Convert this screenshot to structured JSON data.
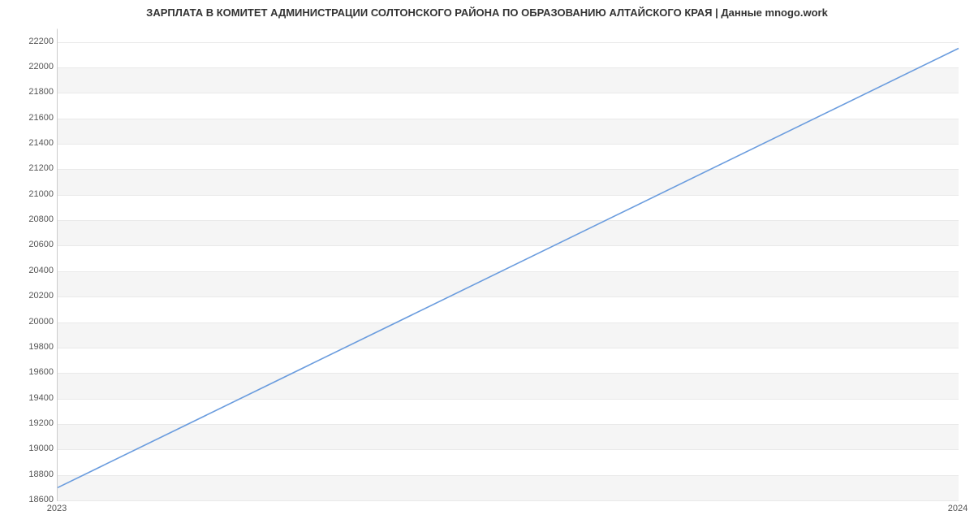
{
  "chart_data": {
    "type": "line",
    "title": "ЗАРПЛАТА В КОМИТЕТ АДМИНИСТРАЦИИ СОЛТОНСКОГО РАЙОНА ПО ОБРАЗОВАНИЮ АЛТАЙСКОГО КРАЯ | Данные mnogo.work",
    "xlabel": "",
    "ylabel": "",
    "x": [
      2023,
      2024
    ],
    "values": [
      18700,
      22150
    ],
    "x_ticks": [
      2023,
      2024
    ],
    "y_ticks": [
      18600,
      18800,
      19000,
      19200,
      19400,
      19600,
      19800,
      20000,
      20200,
      20400,
      20600,
      20800,
      21000,
      21200,
      21400,
      21600,
      21800,
      22000,
      22200
    ],
    "ylim": [
      18600,
      22300
    ],
    "xlim": [
      2023,
      2024
    ],
    "line_color": "#6a9cde"
  }
}
